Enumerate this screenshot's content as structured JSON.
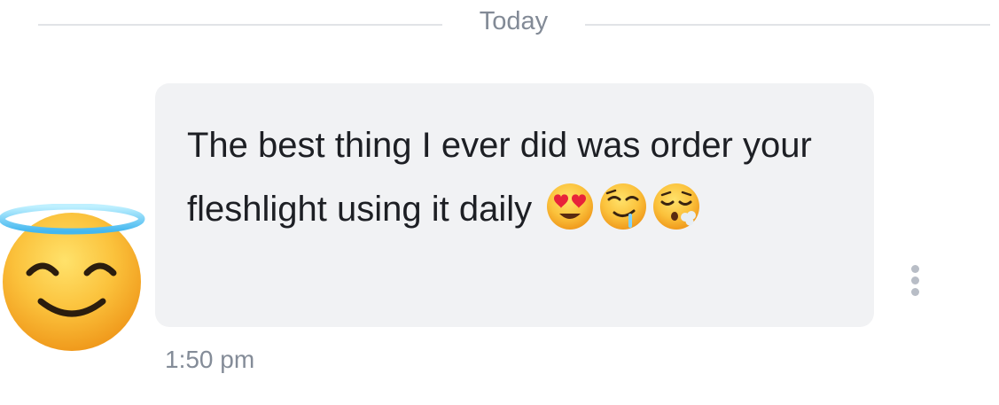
{
  "conversation": {
    "date_divider": "Today",
    "message": {
      "sender_avatar_icon": "smiling-face-with-halo-icon",
      "text_parts": [
        "The best thing I ever did was order your fleshlight using it daily"
      ],
      "emoji_icons": [
        "heart-eyes-emoji-icon",
        "drooling-face-emoji-icon",
        "face-exhaling-emoji-icon"
      ],
      "timestamp": "1:50 pm",
      "bubble_color": "#f1f2f4"
    },
    "more_options_icon": "vertical-ellipsis-icon"
  }
}
